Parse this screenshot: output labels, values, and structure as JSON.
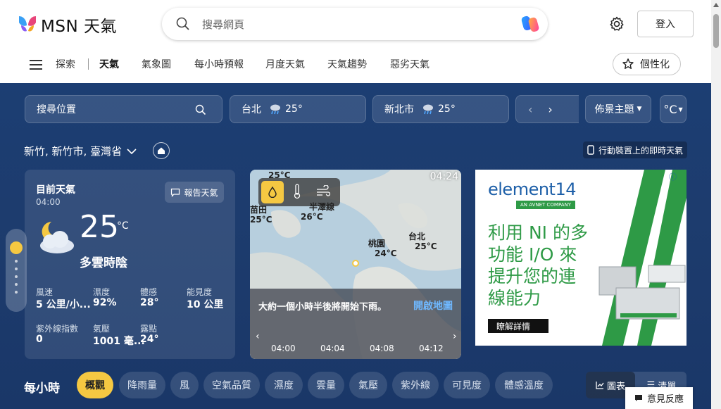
{
  "header": {
    "logo_text": "MSN 天氣",
    "search_placeholder": "搜尋網頁",
    "login_label": "登入"
  },
  "nav": {
    "items": [
      "探索",
      "天氣",
      "氣象圖",
      "每小時預報",
      "月度天氣",
      "天氣趨勢",
      "惡劣天氣"
    ],
    "active": "天氣",
    "personalize_label": "個性化"
  },
  "location_bar": {
    "search_label": "搜尋位置",
    "saved": [
      {
        "city": "台北",
        "temp": "25°"
      },
      {
        "city": "新北市",
        "temp": "25°"
      }
    ],
    "theme_label": "佈景主題",
    "unit_label": "°C"
  },
  "location": {
    "name": "新竹, 新竹市, 臺灣省",
    "mobile_label": "行動裝置上的即時天氣"
  },
  "current": {
    "title": "目前天氣",
    "time": "04:00",
    "report_label": "報告天氣",
    "temp": "25",
    "unit": "°C",
    "condition": "多雲時陰",
    "details": [
      {
        "label": "風速",
        "value": "5 公里/小..."
      },
      {
        "label": "濕度",
        "value": "92%"
      },
      {
        "label": "體感",
        "value": "28°"
      },
      {
        "label": "能見度",
        "value": "10 公里"
      },
      {
        "label": "紫外線指數",
        "value": "0"
      },
      {
        "label": "氣壓",
        "value": "1001 毫..."
      },
      {
        "label": "露點",
        "value": "24°"
      }
    ]
  },
  "map": {
    "time": "04:24",
    "places": [
      {
        "name": "",
        "temp": "25°C"
      },
      {
        "name": "苗田",
        "temp": "25°C"
      },
      {
        "name": "半澤線",
        "temp": "26°C"
      },
      {
        "name": "桃園",
        "temp": "24°C"
      },
      {
        "name": "台北",
        "temp": "25°C"
      }
    ],
    "message": "大約一個小時半後將開始下雨。",
    "open_map_label": "開啟地圖",
    "timeline": [
      "04:00",
      "04:04",
      "04:08",
      "04:12"
    ]
  },
  "ad": {
    "brand": "element14",
    "brand_sub": "AN AVNET COMPANY",
    "headline_lines": [
      "利用 NI 的多",
      "功能 I/O 來",
      "提升您的連",
      "線能力"
    ],
    "cta": "瞭解詳情"
  },
  "hourly": {
    "title": "每小時",
    "chips": [
      "概觀",
      "降雨量",
      "風",
      "空氣品質",
      "濕度",
      "雲量",
      "氣壓",
      "紫外線",
      "可見度",
      "體感溫度"
    ],
    "active": "概觀",
    "view_chart": "圖表",
    "view_list": "清單"
  },
  "feedback_label": "意見反應",
  "colors": {
    "accent": "#f5c842",
    "link": "#6fb8ff",
    "bg": "#1c3e73"
  }
}
